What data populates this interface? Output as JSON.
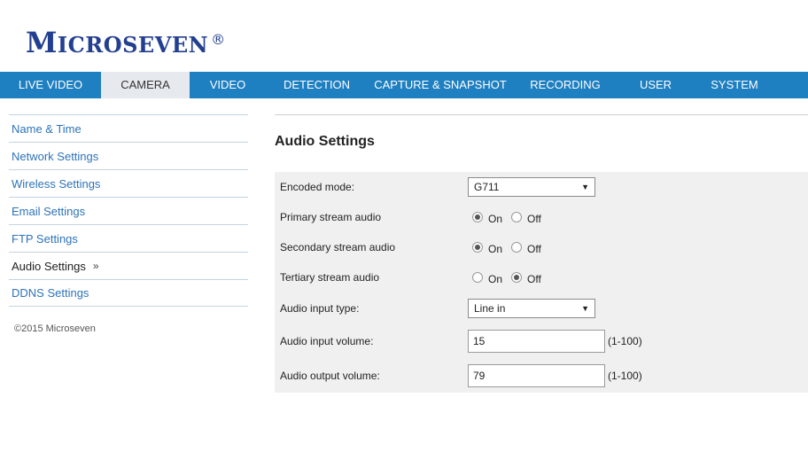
{
  "brand": {
    "logo_first": "M",
    "logo_rest": "ICROSEVEN",
    "logo_mark": "®",
    "color": "#233f90"
  },
  "nav": {
    "accent": "#1e7fc1",
    "tabs": [
      {
        "label": "LIVE VIDEO"
      },
      {
        "label": "CAMERA"
      },
      {
        "label": "VIDEO"
      },
      {
        "label": "DETECTION"
      },
      {
        "label": "CAPTURE & SNAPSHOT"
      },
      {
        "label": "RECORDING"
      },
      {
        "label": "USER"
      },
      {
        "label": "SYSTEM"
      }
    ],
    "active": "CAMERA"
  },
  "sidebar": {
    "items": [
      {
        "label": "Name & Time"
      },
      {
        "label": "Network Settings"
      },
      {
        "label": "Wireless Settings"
      },
      {
        "label": "Email Settings"
      },
      {
        "label": "FTP Settings"
      },
      {
        "label": "Audio Settings",
        "marker": "»"
      },
      {
        "label": "DDNS Settings"
      }
    ],
    "active": "Audio Settings",
    "copyright": "©2015 Microseven"
  },
  "main": {
    "title": "Audio Settings",
    "fields": {
      "encoded_mode": {
        "label": "Encoded mode:",
        "value": "G711"
      },
      "primary_audio": {
        "label": "Primary stream audio",
        "on": "On",
        "off": "Off",
        "selected": "On"
      },
      "secondary_audio": {
        "label": "Secondary stream audio",
        "on": "On",
        "off": "Off",
        "selected": "On"
      },
      "tertiary_audio": {
        "label": "Tertiary stream audio",
        "on": "On",
        "off": "Off",
        "selected": "Off"
      },
      "input_type": {
        "label": "Audio input type:",
        "value": "Line in"
      },
      "input_volume": {
        "label": "Audio input volume:",
        "value": "15",
        "range": "(1-100)"
      },
      "output_volume": {
        "label": "Audio output volume:",
        "value": "79",
        "range": "(1-100)"
      }
    }
  }
}
